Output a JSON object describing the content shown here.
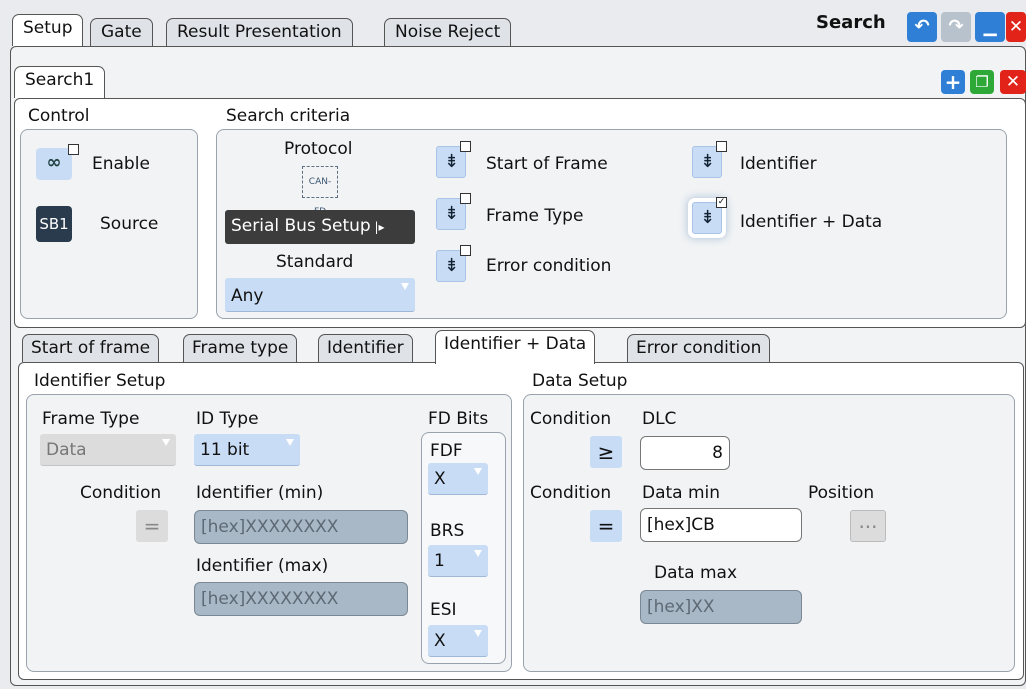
{
  "window": {
    "title": "Search"
  },
  "top_tabs": [
    "Setup",
    "Gate",
    "Result Presentation",
    "Noise Reject"
  ],
  "search_tab": "Search1",
  "control": {
    "title": "Control",
    "enable_label": "Enable",
    "source_label": "Source",
    "source_icon": "SB1"
  },
  "criteria": {
    "title": "Search criteria",
    "protocol_label": "Protocol",
    "protocol_icon": "CAN-FD",
    "setup_button": "Serial Bus Setup",
    "standard_label": "Standard",
    "standard_value": "Any",
    "options": [
      {
        "label": "Start of Frame",
        "checked": false
      },
      {
        "label": "Frame Type",
        "checked": false
      },
      {
        "label": "Error condition",
        "checked": false
      },
      {
        "label": "Identifier",
        "checked": false
      },
      {
        "label": "Identifier + Data",
        "checked": true
      }
    ]
  },
  "sub_tabs": [
    "Start of frame",
    "Frame type",
    "Identifier",
    "Identifier + Data",
    "Error condition"
  ],
  "identifier_setup": {
    "title": "Identifier Setup",
    "frame_type_label": "Frame Type",
    "frame_type_value": "Data",
    "id_type_label": "ID Type",
    "id_type_value": "11 bit",
    "condition_label": "Condition",
    "condition_value": "=",
    "id_min_label": "Identifier (min)",
    "id_min_value": "[hex]XXXXXXXX",
    "id_max_label": "Identifier (max)",
    "id_max_value": "[hex]XXXXXXXX",
    "fd_bits_label": "FD Bits",
    "fdf_label": "FDF",
    "fdf_value": "X",
    "brs_label": "BRS",
    "brs_value": "1",
    "esi_label": "ESI",
    "esi_value": "X"
  },
  "data_setup": {
    "title": "Data Setup",
    "condition1_label": "Condition",
    "condition1_value": "≥",
    "dlc_label": "DLC",
    "dlc_value": "8",
    "condition2_label": "Condition",
    "condition2_value": "=",
    "data_min_label": "Data min",
    "data_min_value": "[hex]CB",
    "position_label": "Position",
    "position_value": "···",
    "data_max_label": "Data max",
    "data_max_value": "[hex]XX"
  },
  "colors": {
    "accent_blue": "#2f7fd6",
    "close_red": "#e2231a",
    "dropdown_blue": "#c9dcf5"
  }
}
